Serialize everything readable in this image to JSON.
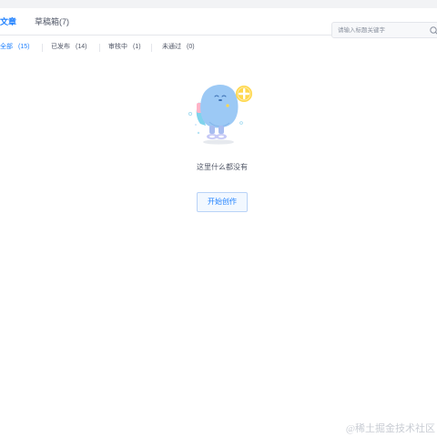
{
  "tabs": {
    "articles": "文章",
    "drafts": "草稿箱(7)"
  },
  "search": {
    "placeholder": "请输入标题关键字"
  },
  "filters": [
    {
      "label": "全部",
      "count": "(15)"
    },
    {
      "label": "已发布",
      "count": "(14)"
    },
    {
      "label": "审核中",
      "count": "(1)"
    },
    {
      "label": "未通过",
      "count": "(0)"
    }
  ],
  "empty": {
    "message": "这里什么都没有",
    "button": "开始创作"
  },
  "watermark": "@稀土掘金技术社区",
  "colors": {
    "accent": "#1e80ff",
    "text_secondary": "#515767",
    "border": "#e5e6eb"
  },
  "icons": {
    "search": "search-icon",
    "illustration": "empty-state-illustration"
  }
}
